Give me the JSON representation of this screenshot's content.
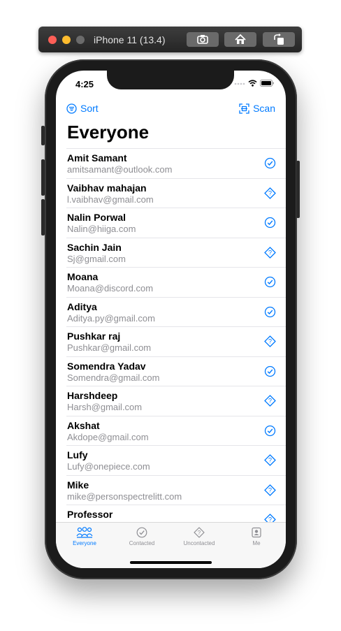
{
  "simulator": {
    "title": "iPhone 11 (13.4)",
    "buttons": [
      "screenshot-icon",
      "home-icon",
      "rotate-icon"
    ]
  },
  "status_bar": {
    "time": "4:25"
  },
  "nav": {
    "sort_label": "Sort",
    "scan_label": "Scan"
  },
  "page_title": "Everyone",
  "colors": {
    "accent": "#007aff",
    "secondary_text": "#8e8e93"
  },
  "contacts": [
    {
      "name": "Amit Samant",
      "email": "amitsamant@outlook.com",
      "status": "contacted"
    },
    {
      "name": "Vaibhav mahajan",
      "email": "l.vaibhav@gmail.com",
      "status": "uncontacted"
    },
    {
      "name": "Nalin Porwal",
      "email": "Nalin@hiiga.com",
      "status": "contacted"
    },
    {
      "name": "Sachin Jain",
      "email": "Sj@gmail.com",
      "status": "uncontacted"
    },
    {
      "name": "Moana",
      "email": "Moana@discord.com",
      "status": "contacted"
    },
    {
      "name": "Aditya",
      "email": "Aditya.py@gmail.com",
      "status": "contacted"
    },
    {
      "name": "Pushkar raj",
      "email": "Pushkar@gmail.com",
      "status": "uncontacted"
    },
    {
      "name": "Somendra Yadav",
      "email": "Somendra@gmail.com",
      "status": "contacted"
    },
    {
      "name": "Harshdeep",
      "email": "Harsh@gmail.com",
      "status": "uncontacted"
    },
    {
      "name": "Akshat",
      "email": "Akdope@gmail.com",
      "status": "contacted"
    },
    {
      "name": "Lufy",
      "email": "Lufy@onepiece.com",
      "status": "uncontacted"
    },
    {
      "name": "Mike",
      "email": "mike@personspectrelitt.com",
      "status": "uncontacted"
    },
    {
      "name": "Professor",
      "email": "",
      "status": "uncontacted"
    }
  ],
  "tabs": [
    {
      "label": "Everyone",
      "icon": "people-icon",
      "active": true
    },
    {
      "label": "Contacted",
      "icon": "checkmark-circle-icon",
      "active": false
    },
    {
      "label": "Uncontacted",
      "icon": "questionmark-diamond-icon",
      "active": false
    },
    {
      "label": "Me",
      "icon": "person-square-icon",
      "active": false
    }
  ]
}
